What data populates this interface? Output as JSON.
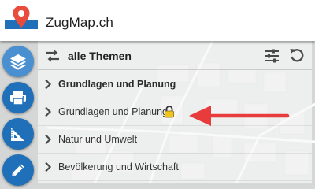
{
  "app": {
    "title": "ZugMap.ch"
  },
  "colors": {
    "toolbar_button": "#1f70b8",
    "toolbar_button_active": "#4a8fd0",
    "arrow": "#e83b3b",
    "logo_pin": "#e94b3c",
    "logo_band": "#1f70b8"
  },
  "toolbar": {
    "buttons": [
      {
        "icon": "layers-icon",
        "active": true
      },
      {
        "icon": "printer-icon",
        "active": false
      },
      {
        "icon": "measure-icon",
        "active": false
      },
      {
        "icon": "pencil-icon",
        "active": false
      }
    ]
  },
  "panel": {
    "title": "alle Themen",
    "icons": [
      "swap-icon",
      "filter-sliders-icon",
      "reset-icon"
    ],
    "items": [
      {
        "label": "Grundlagen und Planung",
        "bold": true,
        "locked": false
      },
      {
        "label": "Grundlagen und Planung",
        "bold": false,
        "locked": true
      },
      {
        "label": "Natur und Umwelt",
        "bold": false,
        "locked": false
      },
      {
        "label": "Bevölkerung und Wirtschaft",
        "bold": false,
        "locked": false
      }
    ]
  }
}
